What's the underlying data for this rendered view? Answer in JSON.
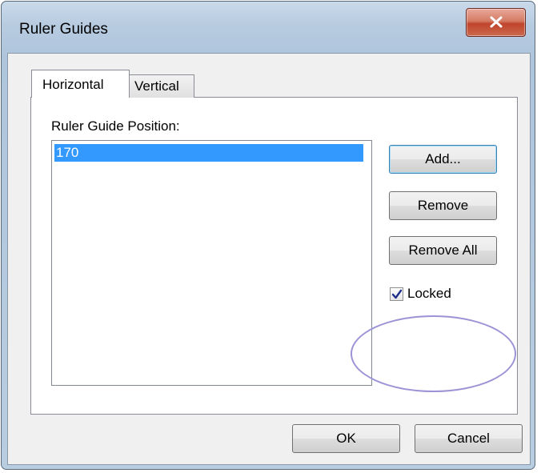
{
  "window": {
    "title": "Ruler Guides"
  },
  "tabs": [
    {
      "label": "Horizontal",
      "selected": true
    },
    {
      "label": "Vertical",
      "selected": false
    }
  ],
  "panel": {
    "position_label": "Ruler Guide Position:",
    "positions": [
      "170"
    ],
    "selected_position": "170"
  },
  "buttons": {
    "add": "Add...",
    "remove": "Remove",
    "remove_all": "Remove All",
    "ok": "OK",
    "cancel": "Cancel"
  },
  "locked": {
    "label": "Locked",
    "checked": true
  },
  "colors": {
    "selection": "#3399ff",
    "annotation": "#9b93d6",
    "close_button": "#c0442b"
  }
}
